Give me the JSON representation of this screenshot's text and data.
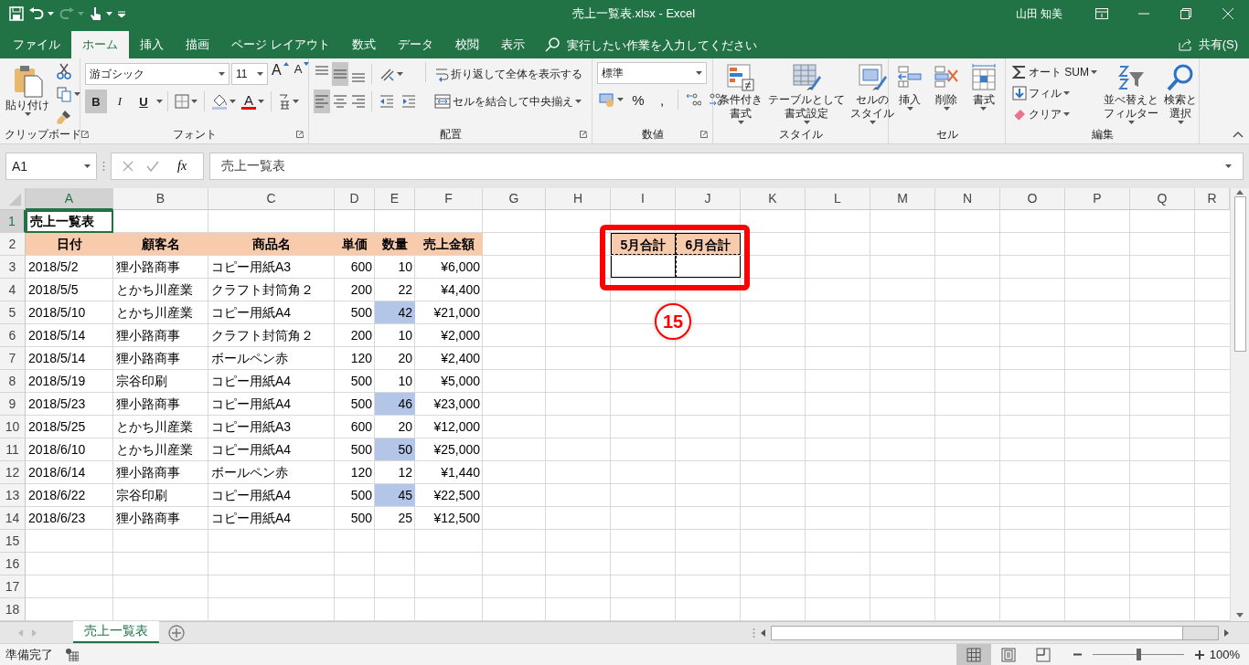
{
  "window": {
    "title": "売上一覧表.xlsx  -  Excel",
    "user": "山田 知美"
  },
  "ribbon_tabs": [
    {
      "label": "ファイル",
      "selected": false
    },
    {
      "label": "ホーム",
      "selected": true
    },
    {
      "label": "挿入",
      "selected": false
    },
    {
      "label": "描画",
      "selected": false
    },
    {
      "label": "ページ レイアウト",
      "selected": false
    },
    {
      "label": "数式",
      "selected": false
    },
    {
      "label": "データ",
      "selected": false
    },
    {
      "label": "校閲",
      "selected": false
    },
    {
      "label": "表示",
      "selected": false
    }
  ],
  "tell_me": {
    "placeholder": "実行したい作業を入力してください"
  },
  "share": "共有(S)",
  "ribbon": {
    "groups": [
      {
        "kind": "clipboard",
        "label": "クリップボード",
        "launcher": true,
        "paste": "貼り付け"
      },
      {
        "kind": "font",
        "label": "フォント",
        "launcher": true,
        "font": "游ゴシック",
        "size": "11",
        "size_buttons": [
          "A",
          "A"
        ],
        "styles": [
          {
            "label": "B",
            "pressed": true
          },
          {
            "label": "I",
            "pressed": false
          },
          {
            "label": "U",
            "pressed": false
          }
        ],
        "font_color": "A"
      },
      {
        "kind": "alignment",
        "label": "配置",
        "launcher": true,
        "vertical": [
          {
            "pressed": false
          },
          {
            "pressed": true
          },
          {
            "pressed": false
          }
        ],
        "horizontal": [
          {
            "pressed": true
          },
          {
            "pressed": false
          },
          {
            "pressed": false
          }
        ],
        "wrap": "折り返して全体を表示する",
        "merge": "セルを結合して中央揃え"
      },
      {
        "kind": "number",
        "label": "数値",
        "launcher": true,
        "format": "標準",
        "symbols": [
          "%",
          ","
        ]
      },
      {
        "kind": "styles",
        "label": "スタイル",
        "buttons": [
          {
            "lines": [
              "条件付き",
              "書式"
            ]
          },
          {
            "lines": [
              "テーブルとして",
              "書式設定"
            ]
          },
          {
            "lines": [
              "セルの",
              "スタイル"
            ]
          }
        ]
      },
      {
        "kind": "cells",
        "label": "セル",
        "buttons": [
          {
            "lines": [
              "挿入"
            ]
          },
          {
            "lines": [
              "削除"
            ]
          },
          {
            "lines": [
              "書式"
            ]
          }
        ]
      },
      {
        "kind": "editing",
        "label": "編集",
        "small": [
          "オート SUM",
          "フィル",
          "クリア"
        ],
        "buttons": [
          {
            "lines": [
              "並べ替えと",
              "フィルター"
            ]
          },
          {
            "lines": [
              "検索と",
              "選択"
            ]
          }
        ]
      }
    ]
  },
  "formula_bar": {
    "name_box": "A1",
    "fx": "fx",
    "value": "売上一覧表"
  },
  "sheet": {
    "columns": [
      {
        "label": "A",
        "selected": true
      },
      {
        "label": "B",
        "selected": false
      },
      {
        "label": "C",
        "selected": false
      },
      {
        "label": "D",
        "selected": false
      },
      {
        "label": "E",
        "selected": false
      },
      {
        "label": "F",
        "selected": false
      },
      {
        "label": "G",
        "selected": false
      },
      {
        "label": "H",
        "selected": false
      },
      {
        "label": "I",
        "selected": false
      },
      {
        "label": "J",
        "selected": false
      },
      {
        "label": "K",
        "selected": false
      },
      {
        "label": "L",
        "selected": false
      },
      {
        "label": "M",
        "selected": false
      },
      {
        "label": "N",
        "selected": false
      },
      {
        "label": "O",
        "selected": false
      },
      {
        "label": "P",
        "selected": false
      },
      {
        "label": "Q",
        "selected": false
      },
      {
        "label": "R",
        "selected": false
      }
    ],
    "rows": [
      {
        "label": "1",
        "selected": true,
        "cells": [
          {
            "kind": "title",
            "text": "売上一覧表"
          }
        ]
      },
      {
        "label": "2",
        "selected": false,
        "cells": [
          {
            "kind": "header",
            "text": "日付"
          },
          {
            "kind": "header",
            "text": "顧客名"
          },
          {
            "kind": "header",
            "text": "商品名"
          },
          {
            "kind": "header",
            "text": "単価"
          },
          {
            "kind": "header",
            "text": "数量"
          },
          {
            "kind": "header",
            "text": "売上金額"
          },
          {
            "kind": "empty"
          },
          {
            "kind": "empty"
          },
          {
            "kind": "total-header",
            "text": "5月合計"
          },
          {
            "kind": "total-header",
            "text": "6月合計"
          }
        ]
      },
      {
        "label": "3",
        "selected": false,
        "cells": [
          {
            "kind": "text",
            "text": "2018/5/2",
            "highlighted": false
          },
          {
            "kind": "text",
            "text": "狸小路商事",
            "highlighted": false
          },
          {
            "kind": "text",
            "text": "コピー用紙A3",
            "highlighted": false
          },
          {
            "kind": "number",
            "text": "600",
            "highlighted": false
          },
          {
            "kind": "number",
            "text": "10",
            "highlighted": false
          },
          {
            "kind": "number",
            "text": "¥6,000",
            "highlighted": false
          },
          {
            "kind": "empty"
          },
          {
            "kind": "empty"
          },
          {
            "kind": "total-input"
          },
          {
            "kind": "total-input"
          }
        ]
      },
      {
        "label": "4",
        "selected": false,
        "cells": [
          {
            "kind": "text",
            "text": "2018/5/5",
            "highlighted": false
          },
          {
            "kind": "text",
            "text": "とかち川産業",
            "highlighted": false
          },
          {
            "kind": "text",
            "text": "クラフト封筒角２",
            "highlighted": false
          },
          {
            "kind": "number",
            "text": "200",
            "highlighted": false
          },
          {
            "kind": "number",
            "text": "22",
            "highlighted": false
          },
          {
            "kind": "number",
            "text": "¥4,400",
            "highlighted": false
          }
        ]
      },
      {
        "label": "5",
        "selected": false,
        "cells": [
          {
            "kind": "text",
            "text": "2018/5/10",
            "highlighted": false
          },
          {
            "kind": "text",
            "text": "とかち川産業",
            "highlighted": false
          },
          {
            "kind": "text",
            "text": "コピー用紙A4",
            "highlighted": false
          },
          {
            "kind": "number",
            "text": "500",
            "highlighted": false
          },
          {
            "kind": "number",
            "text": "42",
            "highlighted": true
          },
          {
            "kind": "number",
            "text": "¥21,000",
            "highlighted": false
          }
        ]
      },
      {
        "label": "6",
        "selected": false,
        "cells": [
          {
            "kind": "text",
            "text": "2018/5/14",
            "highlighted": false
          },
          {
            "kind": "text",
            "text": "狸小路商事",
            "highlighted": false
          },
          {
            "kind": "text",
            "text": "クラフト封筒角２",
            "highlighted": false
          },
          {
            "kind": "number",
            "text": "200",
            "highlighted": false
          },
          {
            "kind": "number",
            "text": "10",
            "highlighted": false
          },
          {
            "kind": "number",
            "text": "¥2,000",
            "highlighted": false
          }
        ]
      },
      {
        "label": "7",
        "selected": false,
        "cells": [
          {
            "kind": "text",
            "text": "2018/5/14",
            "highlighted": false
          },
          {
            "kind": "text",
            "text": "狸小路商事",
            "highlighted": false
          },
          {
            "kind": "text",
            "text": "ボールペン赤",
            "highlighted": false
          },
          {
            "kind": "number",
            "text": "120",
            "highlighted": false
          },
          {
            "kind": "number",
            "text": "20",
            "highlighted": false
          },
          {
            "kind": "number",
            "text": "¥2,400",
            "highlighted": false
          }
        ]
      },
      {
        "label": "8",
        "selected": false,
        "cells": [
          {
            "kind": "text",
            "text": "2018/5/19",
            "highlighted": false
          },
          {
            "kind": "text",
            "text": "宗谷印刷",
            "highlighted": false
          },
          {
            "kind": "text",
            "text": "コピー用紙A4",
            "highlighted": false
          },
          {
            "kind": "number",
            "text": "500",
            "highlighted": false
          },
          {
            "kind": "number",
            "text": "10",
            "highlighted": false
          },
          {
            "kind": "number",
            "text": "¥5,000",
            "highlighted": false
          }
        ]
      },
      {
        "label": "9",
        "selected": false,
        "cells": [
          {
            "kind": "text",
            "text": "2018/5/23",
            "highlighted": false
          },
          {
            "kind": "text",
            "text": "狸小路商事",
            "highlighted": false
          },
          {
            "kind": "text",
            "text": "コピー用紙A4",
            "highlighted": false
          },
          {
            "kind": "number",
            "text": "500",
            "highlighted": false
          },
          {
            "kind": "number",
            "text": "46",
            "highlighted": true
          },
          {
            "kind": "number",
            "text": "¥23,000",
            "highlighted": false
          }
        ]
      },
      {
        "label": "10",
        "selected": false,
        "cells": [
          {
            "kind": "text",
            "text": "2018/5/25",
            "highlighted": false
          },
          {
            "kind": "text",
            "text": "とかち川産業",
            "highlighted": false
          },
          {
            "kind": "text",
            "text": "コピー用紙A3",
            "highlighted": false
          },
          {
            "kind": "number",
            "text": "600",
            "highlighted": false
          },
          {
            "kind": "number",
            "text": "20",
            "highlighted": false
          },
          {
            "kind": "number",
            "text": "¥12,000",
            "highlighted": false
          }
        ]
      },
      {
        "label": "11",
        "selected": false,
        "cells": [
          {
            "kind": "text",
            "text": "2018/6/10",
            "highlighted": false
          },
          {
            "kind": "text",
            "text": "とかち川産業",
            "highlighted": false
          },
          {
            "kind": "text",
            "text": "コピー用紙A4",
            "highlighted": false
          },
          {
            "kind": "number",
            "text": "500",
            "highlighted": false
          },
          {
            "kind": "number",
            "text": "50",
            "highlighted": true
          },
          {
            "kind": "number",
            "text": "¥25,000",
            "highlighted": false
          }
        ]
      },
      {
        "label": "12",
        "selected": false,
        "cells": [
          {
            "kind": "text",
            "text": "2018/6/14",
            "highlighted": false
          },
          {
            "kind": "text",
            "text": "狸小路商事",
            "highlighted": false
          },
          {
            "kind": "text",
            "text": "ボールペン赤",
            "highlighted": false
          },
          {
            "kind": "number",
            "text": "120",
            "highlighted": false
          },
          {
            "kind": "number",
            "text": "12",
            "highlighted": false
          },
          {
            "kind": "number",
            "text": "¥1,440",
            "highlighted": false
          }
        ]
      },
      {
        "label": "13",
        "selected": false,
        "cells": [
          {
            "kind": "text",
            "text": "2018/6/22",
            "highlighted": false
          },
          {
            "kind": "text",
            "text": "宗谷印刷",
            "highlighted": false
          },
          {
            "kind": "text",
            "text": "コピー用紙A4",
            "highlighted": false
          },
          {
            "kind": "number",
            "text": "500",
            "highlighted": false
          },
          {
            "kind": "number",
            "text": "45",
            "highlighted": true
          },
          {
            "kind": "number",
            "text": "¥22,500",
            "highlighted": false
          }
        ]
      },
      {
        "label": "14",
        "selected": false,
        "cells": [
          {
            "kind": "text",
            "text": "2018/6/23",
            "highlighted": false
          },
          {
            "kind": "text",
            "text": "狸小路商事",
            "highlighted": false
          },
          {
            "kind": "text",
            "text": "コピー用紙A4",
            "highlighted": false
          },
          {
            "kind": "number",
            "text": "500",
            "highlighted": false
          },
          {
            "kind": "number",
            "text": "25",
            "highlighted": false
          },
          {
            "kind": "number",
            "text": "¥12,500",
            "highlighted": false
          }
        ]
      },
      {
        "label": "15",
        "selected": false,
        "cells": []
      },
      {
        "label": "16",
        "selected": false,
        "cells": []
      },
      {
        "label": "17",
        "selected": false,
        "cells": []
      },
      {
        "label": "18",
        "selected": false,
        "cells": []
      }
    ]
  },
  "annotation": {
    "label": "15"
  },
  "sheet_tabs": [
    {
      "label": "売上一覧表",
      "selected": true
    }
  ],
  "status_bar": {
    "text": "準備完了",
    "views": [
      {
        "selected": true
      },
      {
        "selected": false
      },
      {
        "selected": false
      }
    ],
    "zoom": {
      "level": 0.5,
      "reading": "100%"
    }
  }
}
